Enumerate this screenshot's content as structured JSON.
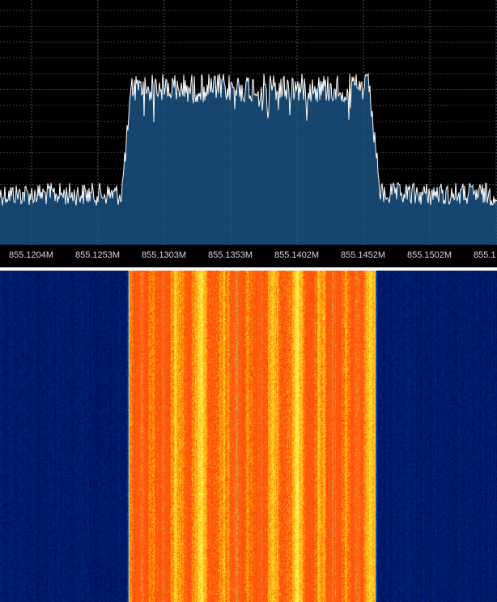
{
  "frequency_axis": {
    "labels": [
      "855.1204M",
      "855.1253M",
      "855.1303M",
      "855.1353M",
      "855.1402M",
      "855.1452M",
      "855.1502M",
      "855.1"
    ]
  },
  "colors": {
    "background": "#000000",
    "spectrum_fill": "#16456e",
    "spectrum_trace": "#ffffff",
    "grid": "#3a3a3a",
    "waterfall_low": "#000c5a",
    "waterfall_high": "#ff5a00",
    "waterfall_peak": "#ffff40"
  },
  "spectrum_data": {
    "signal_band_start_label": "855.1253M",
    "signal_band_end_label": "855.1452M",
    "noise_floor_fraction": 0.18,
    "signal_level_fraction": 0.68
  }
}
